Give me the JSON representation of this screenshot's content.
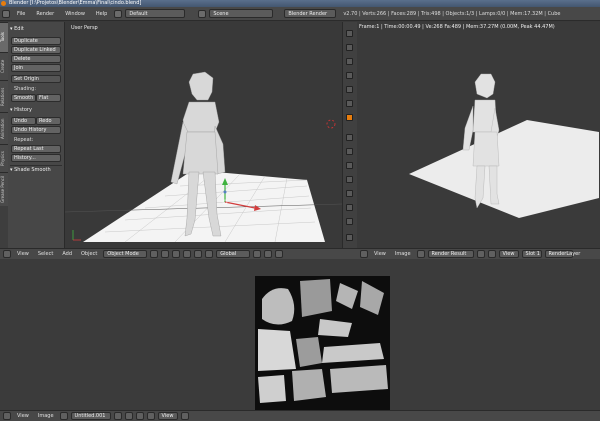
{
  "titlebar": {
    "title": "Blender  [I:\\Projetos\\Blender\\Emma\\Final\\cindo.blend]"
  },
  "info": {
    "menus": [
      "File",
      "Render",
      "Window",
      "Help"
    ],
    "layout": "Default",
    "scene": "Scene",
    "engine": "Blender Render",
    "stats": "v2.70 | Verts:266 | Faces:289 | Tris:498 | Objects:1/3 | Lamps:0/0 | Mem:17.32M | Cube"
  },
  "shelf": {
    "tabs": [
      "Tools",
      "Create",
      "Relations",
      "Animation",
      "Physics",
      "Grease Pencil"
    ],
    "edit_header": "Edit",
    "edit_buttons": [
      "Duplicate",
      "Duplicate Linked",
      "Delete",
      "Join"
    ],
    "set_origin": "Set Origin",
    "shading_label": "Shading:",
    "smooth": "Smooth",
    "flat": "Flat",
    "history_header": "History",
    "undo": "Undo",
    "redo": "Redo",
    "undo_history": "Undo History",
    "repeat_label": "Repeat:",
    "repeat_last": "Repeat Last",
    "history_btn": "History...",
    "operator": "Shade Smooth"
  },
  "viewport": {
    "label": "User Persp",
    "header": {
      "menus": [
        "View",
        "Select",
        "Add",
        "Object"
      ],
      "mode": "Object Mode",
      "orientation": "Global"
    }
  },
  "render": {
    "stats": "Frame:1 | Time:00:00.49 | Ve:268 Fa:489 | Mem:37.27M (0.00M, Peak 44.47M)",
    "header": {
      "menus": [
        "View",
        "Image"
      ],
      "image": "Render Result",
      "view": "View",
      "slot": "Slot 1",
      "layer": "RenderLayer"
    }
  },
  "imageeditor": {
    "header": {
      "menus": [
        "View",
        "Image"
      ],
      "image": "Untitled.001",
      "view": "View"
    }
  },
  "colors": {
    "accent": "#e87d0d",
    "selected": "#5680c2",
    "floor": "#ffffff"
  }
}
